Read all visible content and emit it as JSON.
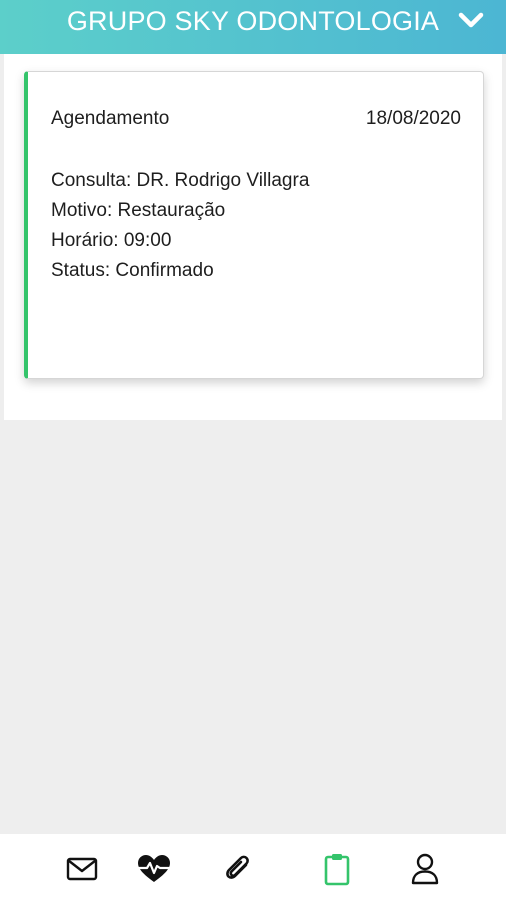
{
  "header": {
    "title": "GRUPO SKY ODONTOLOGIA",
    "menu_icon": "chevron-down-icon"
  },
  "appointment": {
    "type": "Agendamento",
    "date": "18/08/2020",
    "consulta": "Consulta: DR. Rodrigo Villagra",
    "motivo": "Motivo: Restauração",
    "horario": "Horário: 09:00",
    "status": "Status: Confirmado",
    "accent_color": "#34c46b"
  },
  "bottom_nav": {
    "items": [
      {
        "icon": "mail-icon",
        "active": false
      },
      {
        "icon": "heartbeat-icon",
        "active": false
      },
      {
        "icon": "paperclip-icon",
        "active": false
      },
      {
        "icon": "clipboard-icon",
        "active": true
      },
      {
        "icon": "user-icon",
        "active": false
      }
    ],
    "active_color": "#34c46b",
    "inactive_color": "#111111"
  },
  "colors": {
    "header_gradient_start": "#5ccfca",
    "header_gradient_end": "#4cb6d3",
    "background": "#eeeeee"
  }
}
